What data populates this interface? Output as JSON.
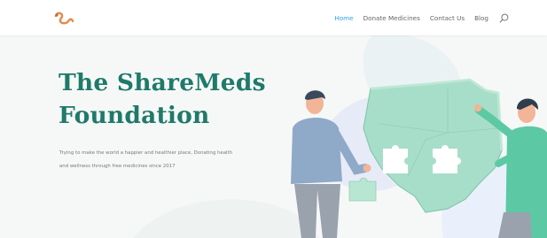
{
  "nav": {
    "items": [
      {
        "label": "Home",
        "active": true
      },
      {
        "label": "Donate Medicines",
        "active": false
      },
      {
        "label": "Contact Us",
        "active": false
      },
      {
        "label": "Blog",
        "active": false
      }
    ],
    "search_icon": "search-icon"
  },
  "hero": {
    "title_line1": "The ShareMeds",
    "title_line2": "Foundation",
    "text_line1": "Trying to make the world a happier and healthier place, Donating health",
    "text_line2": "and wellness through free medicines since 2017"
  },
  "colors": {
    "accent": "#2ea3f2",
    "title": "#1f7a6a",
    "map": "#9fd9c3"
  }
}
